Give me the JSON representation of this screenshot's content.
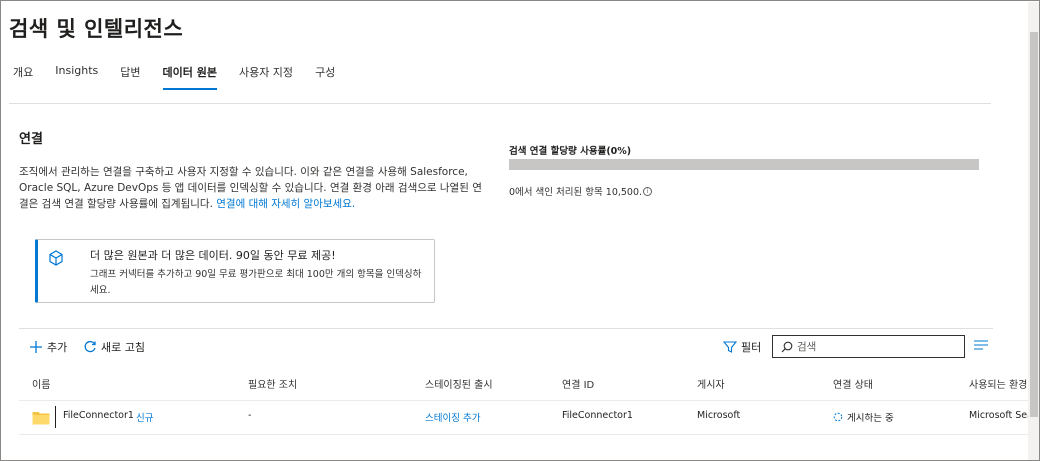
{
  "page": {
    "title": "검색 및 인텔리전스"
  },
  "tabs": [
    {
      "label": "개요"
    },
    {
      "label": "Insights"
    },
    {
      "label": "답변"
    },
    {
      "label": "데이터 원본",
      "active": true
    },
    {
      "label": "사용자 지정"
    },
    {
      "label": "구성"
    }
  ],
  "connections": {
    "title": "연결",
    "description": "조직에서 관리하는 연결을 구축하고 사용자 지정할 수 있습니다. 이와 같은 연결을 사용해 Salesforce, Oracle SQL, Azure DevOps 등 앱 데이터를 인덱싱할 수 있습니다. 연결 환경 아래 검색으로 나열된 연결은 검색 연결 할당량 사용률에 집계됩니다.",
    "learn_more_link": "연결에 대해 자세히 알아보세요."
  },
  "quota": {
    "title": "검색 연결 할당량 사용률(0%)",
    "percent": 0,
    "note": "0에서 색인 처리된 항목 10,500."
  },
  "promo": {
    "title": "더 많은 원본과 더 많은 데이터. 90일 동안 무료 제공!",
    "body": "그래프 커넥터를 추가하고 90일 무료 평가판으로 최대 100만 개의 항목을 인덱싱하세요."
  },
  "toolbar": {
    "add_label": "추가",
    "refresh_label": "새로 고침",
    "filter_label": "필터",
    "search_placeholder": "검색"
  },
  "table": {
    "columns": [
      "이름",
      "필요한 조치",
      "스테이징된 출시",
      "연결 ID",
      "게시자",
      "연결 상태",
      "사용되는 환경"
    ],
    "rows": [
      {
        "name": "FileConnector1",
        "badge": "신규",
        "action": "-",
        "staged": "스테이징 추가",
        "connection_id": "FileConnector1",
        "publisher": "Microsoft",
        "status": "게시하는 중",
        "experience": "Microsoft Sear"
      }
    ]
  },
  "colors": {
    "accent": "#0078d4",
    "text": "#201f1e",
    "divider": "#e1dfdd"
  }
}
